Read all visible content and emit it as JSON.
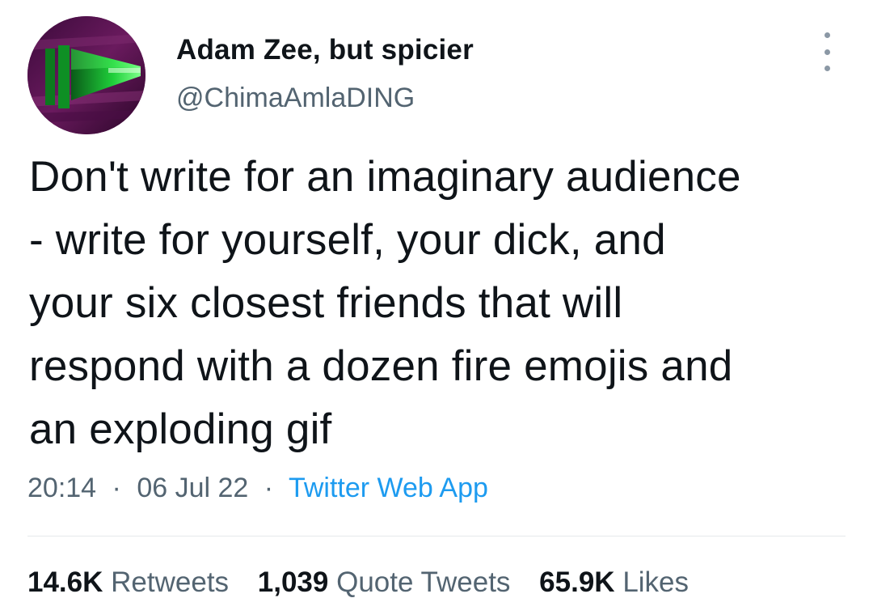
{
  "author": {
    "display_name": "Adam Zee, but spicier",
    "handle": "@ChimaAmlaDING",
    "avatar_icon": "green-spear-avatar-icon"
  },
  "tweet": {
    "text": "Don't write for an imaginary audience\n- write for yourself, your dick, and\nyour six closest friends that will\nrespond with a dozen fire emojis and\nan exploding gif"
  },
  "meta": {
    "time": "20:14",
    "separator": "·",
    "date": "06 Jul 22",
    "source": "Twitter Web App"
  },
  "stats": {
    "retweets_count": "14.6K",
    "retweets_label": "Retweets",
    "quotes_count": "1,039",
    "quotes_label": "Quote Tweets",
    "likes_count": "65.9K",
    "likes_label": "Likes"
  },
  "colors": {
    "text_primary": "#0f1419",
    "text_secondary": "#536471",
    "link": "#1d9bf0",
    "divider": "#e6e9eb"
  }
}
